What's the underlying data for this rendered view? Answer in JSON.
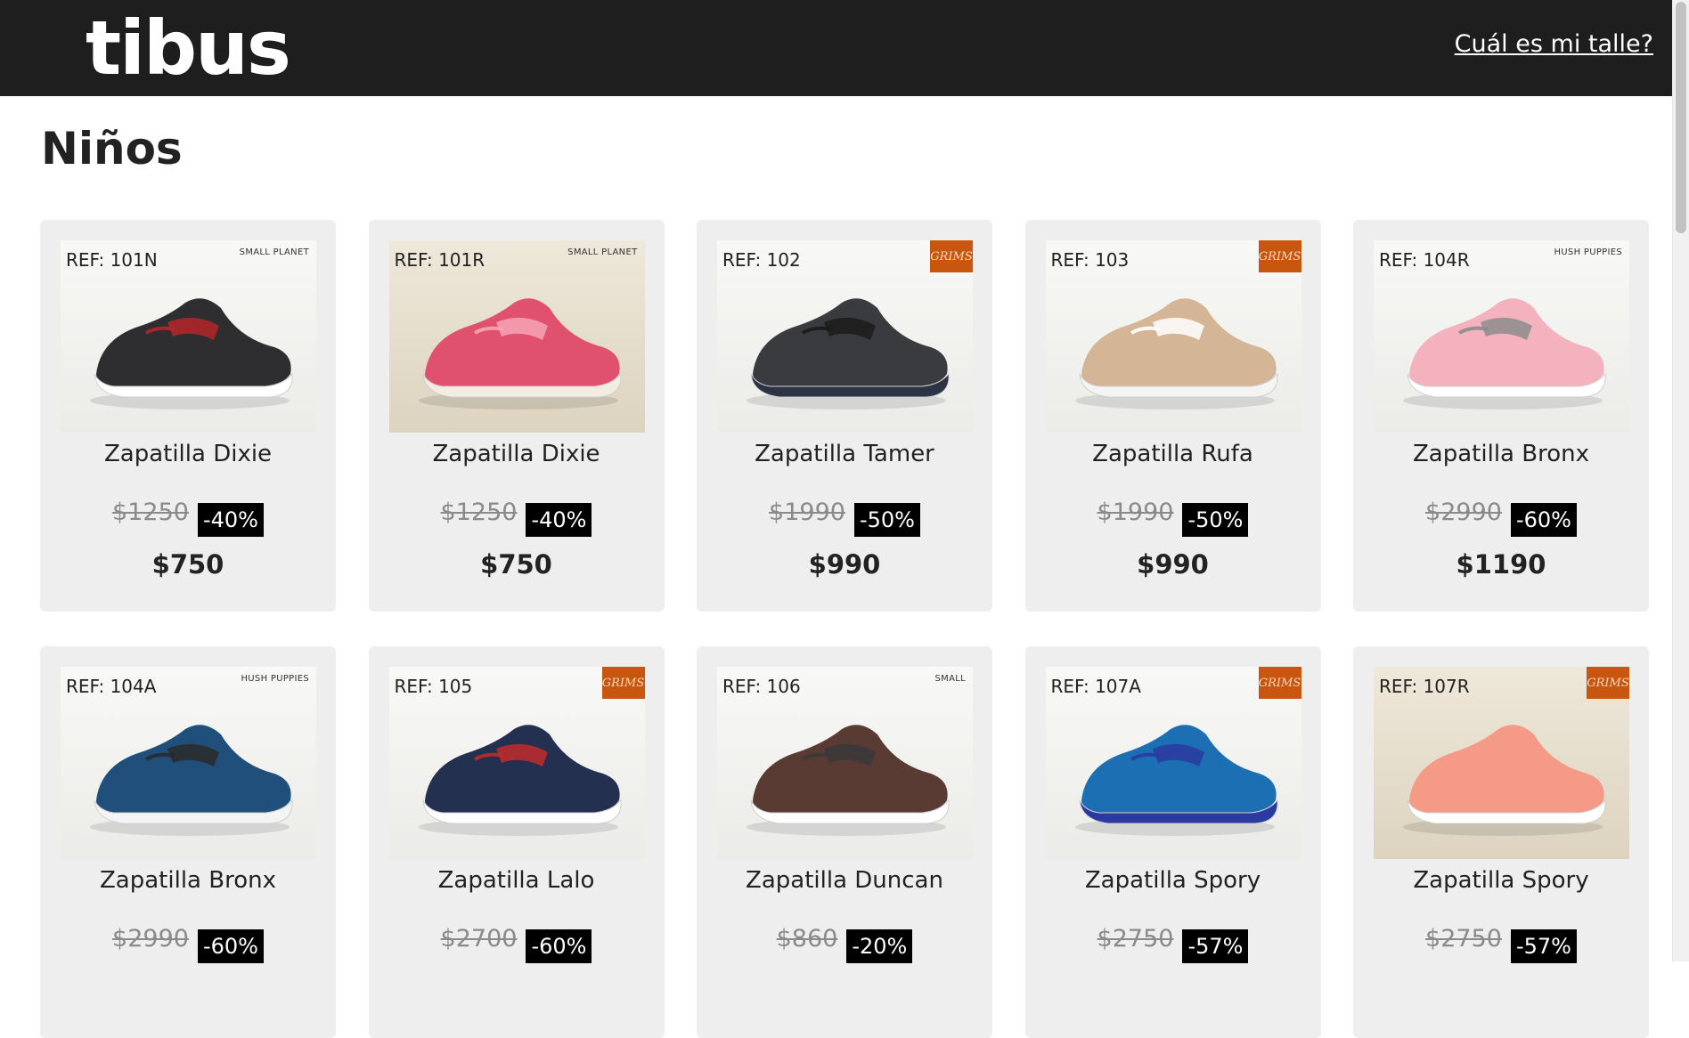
{
  "header": {
    "logo": "tibus",
    "size_link": "Cuál es mi talle?"
  },
  "page_title": "Niños",
  "products": [
    {
      "ref": "REF: 101N",
      "brand": "SMALL PLANET",
      "brand_style": "text",
      "name": "Zapatilla Dixie",
      "old_price": "$1250",
      "discount": "-40%",
      "price": "$750",
      "shoe_color": "#2e2e30",
      "sole_color": "#ffffff",
      "accent_color": "#b3262b",
      "photo": "light"
    },
    {
      "ref": "REF: 101R",
      "brand": "SMALL PLANET",
      "brand_style": "text",
      "name": "Zapatilla Dixie",
      "old_price": "$1250",
      "discount": "-40%",
      "price": "$750",
      "shoe_color": "#e0506f",
      "sole_color": "#f2ece2",
      "accent_color": "#f6a4b5",
      "photo": "warm"
    },
    {
      "ref": "REF: 102",
      "brand": "GRIMS",
      "brand_style": "box",
      "name": "Zapatilla Tamer",
      "old_price": "$1990",
      "discount": "-50%",
      "price": "$990",
      "shoe_color": "#3a3b3f",
      "sole_color": "#2b3345",
      "accent_color": "#1c1c1c",
      "photo": "light"
    },
    {
      "ref": "REF: 103",
      "brand": "GRIMS",
      "brand_style": "box",
      "name": "Zapatilla Rufa",
      "old_price": "$1990",
      "discount": "-50%",
      "price": "$990",
      "shoe_color": "#d4b596",
      "sole_color": "#f4f4f4",
      "accent_color": "#ffffff",
      "photo": "light"
    },
    {
      "ref": "REF: 104R",
      "brand": "HUSH PUPPIES",
      "brand_style": "text",
      "name": "Zapatilla Bronx",
      "old_price": "$2990",
      "discount": "-60%",
      "price": "$1190",
      "shoe_color": "#f3b2bd",
      "sole_color": "#ffffff",
      "accent_color": "#8c8c8c",
      "photo": "light"
    },
    {
      "ref": "REF: 104A",
      "brand": "HUSH PUPPIES",
      "brand_style": "text",
      "name": "Zapatilla Bronx",
      "old_price": "$2990",
      "discount": "-60%",
      "price": "",
      "shoe_color": "#1f4f7a",
      "sole_color": "#f4f4f4",
      "accent_color": "#2a2a2a",
      "photo": "light"
    },
    {
      "ref": "REF: 105",
      "brand": "GRIMS",
      "brand_style": "box",
      "name": "Zapatilla Lalo",
      "old_price": "$2700",
      "discount": "-60%",
      "price": "",
      "shoe_color": "#23304f",
      "sole_color": "#ffffff",
      "accent_color": "#c22a2a",
      "photo": "light"
    },
    {
      "ref": "REF: 106",
      "brand": "SMALL",
      "brand_style": "text",
      "name": "Zapatilla Duncan",
      "old_price": "$860",
      "discount": "-20%",
      "price": "",
      "shoe_color": "#5a3b34",
      "sole_color": "#ffffff",
      "accent_color": "#3a3a3a",
      "photo": "light"
    },
    {
      "ref": "REF: 107A",
      "brand": "GRIMS",
      "brand_style": "box",
      "name": "Zapatilla Spory",
      "old_price": "$2750",
      "discount": "-57%",
      "price": "",
      "shoe_color": "#1d6fb3",
      "sole_color": "#2b3aa0",
      "accent_color": "#2b3aa0",
      "photo": "light"
    },
    {
      "ref": "REF: 107R",
      "brand": "GRIMS",
      "brand_style": "box",
      "name": "Zapatilla Spory",
      "old_price": "$2750",
      "discount": "-57%",
      "price": "",
      "shoe_color": "#f49a86",
      "sole_color": "#ffffff",
      "accent_color": "#f49a86",
      "photo": "warm"
    }
  ]
}
